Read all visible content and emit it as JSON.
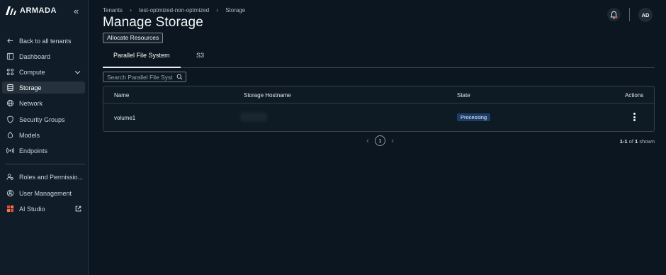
{
  "brand": {
    "name": "ARMADA"
  },
  "sidebar": {
    "back": "Back to all tenants",
    "items": [
      {
        "label": "Dashboard"
      },
      {
        "label": "Compute"
      },
      {
        "label": "Storage"
      },
      {
        "label": "Network"
      },
      {
        "label": "Security Groups"
      },
      {
        "label": "Models"
      },
      {
        "label": "Endpoints"
      },
      {
        "label": "Roles and Permissio..."
      },
      {
        "label": "User Management"
      },
      {
        "label": "AI Studio"
      }
    ]
  },
  "breadcrumb": [
    "Tenants",
    "test-optmized-non-optmized",
    "Storage"
  ],
  "header": {
    "title": "Manage Storage",
    "allocate_label": "Allocate Resources",
    "avatar": "AD"
  },
  "tabs": [
    {
      "label": "Parallel File System",
      "active": true
    },
    {
      "label": "S3",
      "active": false
    }
  ],
  "search": {
    "placeholder": "Search Parallel File Syst"
  },
  "table": {
    "columns": [
      "Name",
      "Storage Hostname",
      "State",
      "Actions"
    ],
    "rows": [
      {
        "name": "volume1",
        "state": "Processing"
      }
    ]
  },
  "pagination": {
    "current": "1",
    "range": "1-1",
    "of_label": "of",
    "total": "1",
    "shown_label": "shown"
  },
  "colors": {
    "background": "#0b1620",
    "sidebar": "#101c27",
    "badge": "#1c3d67",
    "active_nav": "#25323d"
  }
}
